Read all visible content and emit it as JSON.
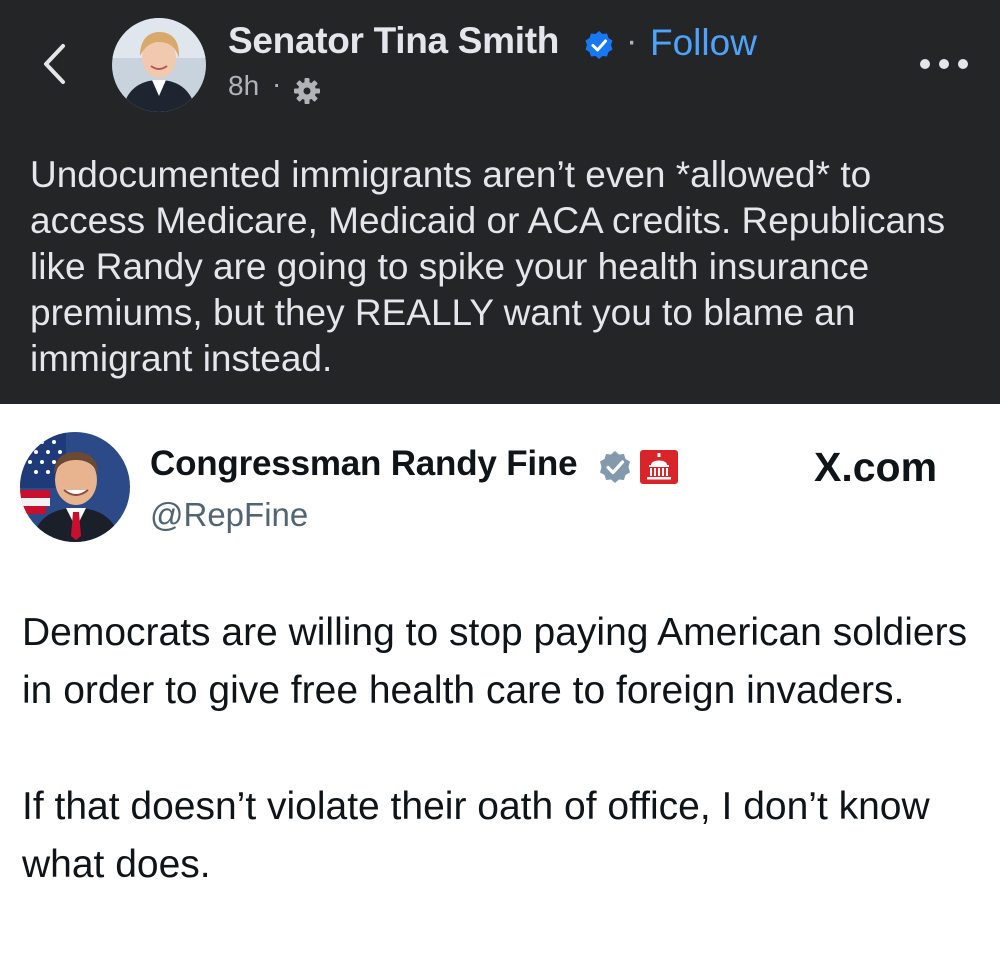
{
  "facebook_post": {
    "author_name": "Senator Tina Smith",
    "follow_label": "Follow",
    "separator": "·",
    "time": "8h",
    "time_separator": "·",
    "privacy_icon": "gear-icon",
    "text": "Undocumented immigrants aren’t even *allowed* to access Medicare, Medicaid or ACA credits. Republicans like Randy are going to spike your health insurance premiums, but they REALLY want you to blame an immigrant instead.",
    "colors": {
      "background": "#242526",
      "text": "#e4e6eb",
      "link": "#4da3ff",
      "verified": "#1877f2"
    }
  },
  "embedded_tweet": {
    "display_name": "Congressman Randy Fine",
    "handle": "@RepFine",
    "source_label": "X.com",
    "badges": [
      "verified-badge-icon",
      "government-badge-icon"
    ],
    "paragraphs": [
      "Democrats are willing to stop paying American soldiers in order to give free health care to foreign invaders.",
      "If that doesn’t violate their oath of office, I don’t know what does."
    ],
    "colors": {
      "background": "#ffffff",
      "text": "#0f1419",
      "handle": "#536471",
      "verified": "#829aab",
      "gov_badge": "#d9252a"
    }
  }
}
